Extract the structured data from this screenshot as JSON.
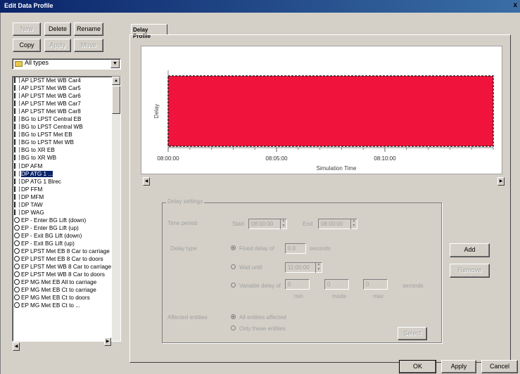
{
  "window": {
    "title": "Edit Data Profile",
    "close_glyph": "x"
  },
  "toolbar": {
    "new": "New",
    "delete": "Delete",
    "rename": "Rename",
    "copy": "Copy",
    "apply": "Apply",
    "move": "Move"
  },
  "filter": {
    "selected": "All types"
  },
  "list_items": [
    {
      "icon": "bar",
      "label": "AP LPST Met WB Car4"
    },
    {
      "icon": "bar",
      "label": "AP LPST Met WB Car5"
    },
    {
      "icon": "bar",
      "label": "AP LPST Met WB Car6"
    },
    {
      "icon": "bar",
      "label": "AP LPST Met WB Car7"
    },
    {
      "icon": "bar",
      "label": "AP LPST Met WB Car8"
    },
    {
      "icon": "bar",
      "label": "BG to LPST Central EB"
    },
    {
      "icon": "bar",
      "label": "BG to LPST Central WB"
    },
    {
      "icon": "bar",
      "label": "BG to LPST Met EB"
    },
    {
      "icon": "bar",
      "label": "BG to LPST Met WB"
    },
    {
      "icon": "bar",
      "label": "BG to XR EB"
    },
    {
      "icon": "bar",
      "label": "BG to XR WB"
    },
    {
      "icon": "bar",
      "label": "DP AFM"
    },
    {
      "icon": "bar",
      "label": "DP ATG 1 ..."
    },
    {
      "icon": "bar",
      "label": "DP ATG 1 Blrec"
    },
    {
      "icon": "bar",
      "label": "DP FFM"
    },
    {
      "icon": "bar",
      "label": "DP MFM"
    },
    {
      "icon": "bar",
      "label": "DP TAW"
    },
    {
      "icon": "bar",
      "label": "DP WAG"
    },
    {
      "icon": "circ",
      "label": "EP - Enter BG Lift (down)"
    },
    {
      "icon": "circ",
      "label": "EP - Enter BG Lift (up)"
    },
    {
      "icon": "circ",
      "label": "EP - Exit BG Lift (down)"
    },
    {
      "icon": "circ",
      "label": "EP - Exit BG Lift (up)"
    },
    {
      "icon": "circ",
      "label": "EP LPST Met EB 8 Car to carriage"
    },
    {
      "icon": "circ",
      "label": "EP LPST Met EB 8 Car to doors"
    },
    {
      "icon": "circ",
      "label": "EP LPST Met WB 8 Car to carriage"
    },
    {
      "icon": "circ",
      "label": "EP LPST Met WB 8 Car to doors"
    },
    {
      "icon": "circ",
      "label": "EP MG Met EB All to carriage"
    },
    {
      "icon": "circ",
      "label": "EP MG Met EB Ct to carriage"
    },
    {
      "icon": "circ",
      "label": "EP MG Met EB Ct to doors"
    },
    {
      "icon": "circ",
      "label": "EP MG Met EB Ct to ..."
    }
  ],
  "selected_index": 12,
  "tab": {
    "label": "Delay Profile"
  },
  "chart_data": {
    "type": "area",
    "xlabel": "Simulation Time",
    "ylabel": "Delay",
    "x_ticks": [
      "08:00:00",
      "08:05:00",
      "08:10:00"
    ],
    "bar_color": "#f0143c",
    "series": [
      {
        "start": "08:00:00",
        "end": "08:15:00"
      }
    ]
  },
  "settings": {
    "group_label": "Delay settings",
    "time_period_label": "Time period",
    "start_label": "Start",
    "start_value": "08:00:00",
    "end_label": "End",
    "end_value": "08:00:00",
    "delay_type_label": "Delay type",
    "fixed_delay_label": "Fixed delay of",
    "fixed_delay_value": "0.0",
    "seconds_label": "seconds",
    "wait_until_label": "Wait until",
    "wait_until_value": "11:00:00",
    "variable_delay_label": "Variable delay of",
    "var_min": "0",
    "var_mode": "0",
    "var_max": "0",
    "var_seconds": "seconds",
    "min_label": "min",
    "mode_label": "mode",
    "max_label": "max",
    "affected_label": "Affected entities",
    "opt_all": "All entities affected",
    "opt_some": "Only these entities",
    "select_btn": "Select"
  },
  "side_buttons": {
    "add": "Add",
    "remove": "Remove"
  },
  "footer": {
    "ok": "OK",
    "apply": "Apply",
    "cancel": "Cancel"
  }
}
